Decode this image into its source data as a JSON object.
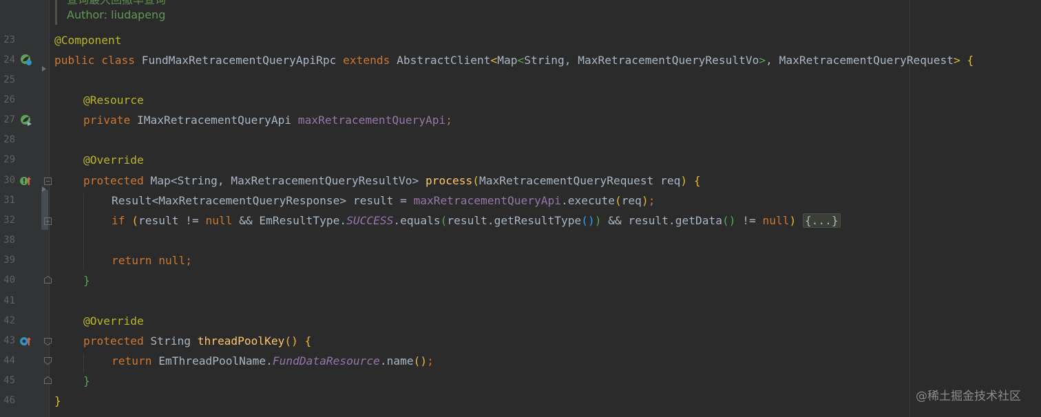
{
  "doc_comment": {
    "chinese_line_partial": "查询最大回撤率查询",
    "author_line": "Author: liudapeng"
  },
  "line_numbers": [
    "23",
    "24",
    "25",
    "26",
    "27",
    "28",
    "29",
    "30",
    "31",
    "32",
    "38",
    "39",
    "40",
    "41",
    "42",
    "43",
    "44",
    "45",
    "46"
  ],
  "code": {
    "l23_annotation": "@Component",
    "l24_public": "public",
    "l24_class": "class",
    "l24_name": "FundMaxRetracementQueryApiRpc",
    "l24_extends": "extends",
    "l24_parent": "AbstractClient",
    "l24_lt": "<",
    "l24_map": "Map",
    "l24_lt2": "<",
    "l24_type1": "String, MaxRetracementQueryResultVo",
    "l24_gt": ">",
    "l24_comma": ", MaxRetracementQueryRequest",
    "l24_gt2": ">",
    "l24_brace": "{",
    "l26_annotation": "@Resource",
    "l27_private": "private",
    "l27_type": "IMaxRetracementQueryApi",
    "l27_field": "maxRetracementQueryApi",
    "l27_semi": ";",
    "l29_annotation": "@Override",
    "l30_protected": "protected",
    "l30_type": "Map<String, MaxRetracementQueryResultVo>",
    "l30_method": "process",
    "l30_paren_open": "(",
    "l30_params": "MaxRetracementQueryRequest req",
    "l30_paren_close": ")",
    "l30_brace": "{",
    "l31_type": "Result<MaxRetracementQueryResponse> result = ",
    "l31_field": "maxRetracementQueryApi",
    "l31_call": ".execute",
    "l31_po": "(",
    "l31_arg": "req",
    "l31_pc": ")",
    "l31_semi": ";",
    "l32_if": "if",
    "l32_po": "(",
    "l32_a": "result != ",
    "l32_null1": "null",
    "l32_b": " && EmResultType.",
    "l32_success": "SUCCESS",
    "l32_c": ".equals",
    "l32_po2": "(",
    "l32_d": "result.getResultType",
    "l32_po3": "()",
    "l32_pc2": ")",
    "l32_e": " && result.getData",
    "l32_po4": "()",
    "l32_f": " != ",
    "l32_null2": "null",
    "l32_pc": ")",
    "l32_fold": "{...}",
    "l39_return": "return",
    "l39_null": "null",
    "l39_semi": ";",
    "l40_brace": "}",
    "l42_annotation": "@Override",
    "l43_protected": "protected",
    "l43_type": "String",
    "l43_method": "threadPoolKey",
    "l43_parens": "()",
    "l43_brace": "{",
    "l44_return": "return",
    "l44_cls": "EmThreadPoolName.",
    "l44_field": "FundDataResource",
    "l44_name": ".name",
    "l44_parens": "()",
    "l44_semi": ";",
    "l45_brace": "}",
    "l46_brace": "}"
  },
  "watermark": "@稀土掘金技术社区",
  "colors": {
    "background": "#2b2b2b",
    "keyword": "#cc7832",
    "annotation": "#bbb529",
    "field": "#9876aa",
    "method": "#ffc66d",
    "default": "#a9b7c6",
    "comment": "#629755"
  },
  "icons": [
    "spring-bean-icon",
    "spring-autowired-icon",
    "override-up-arrow-icon",
    "override-target-icon",
    "fold-icon"
  ]
}
